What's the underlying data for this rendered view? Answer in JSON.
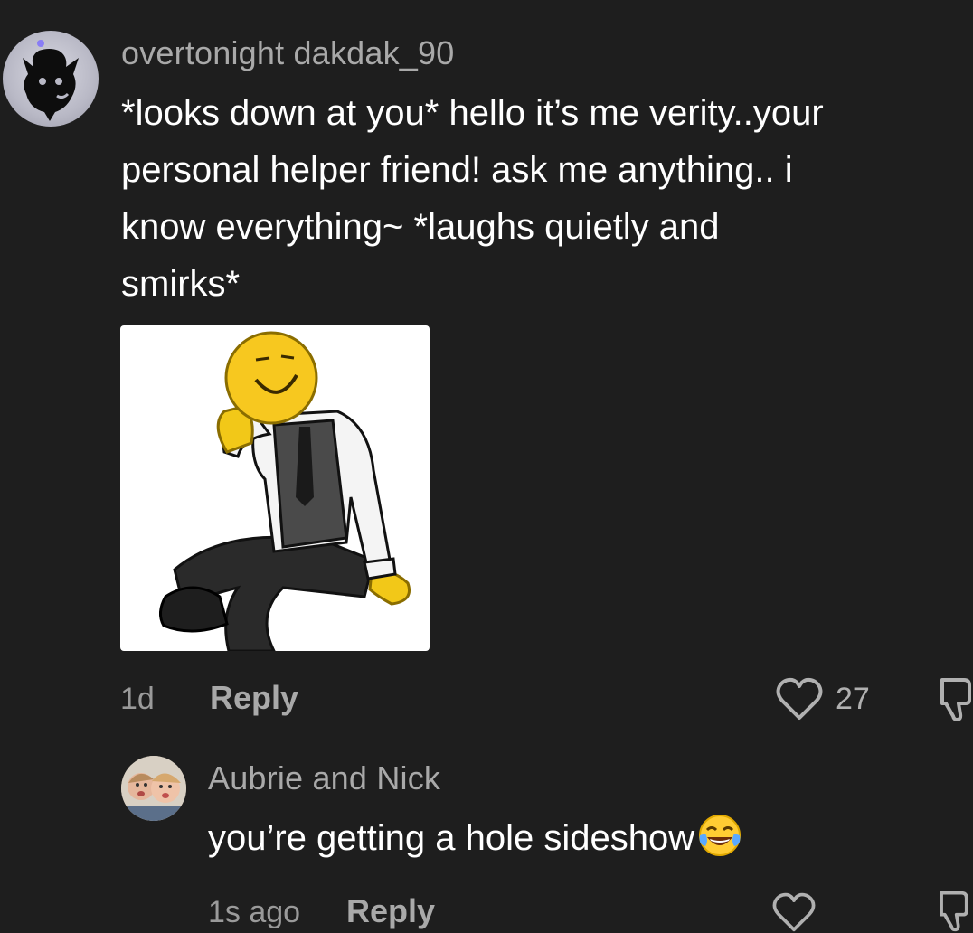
{
  "comment": {
    "username": "overtonight dakdak_90",
    "text": "*looks down at you* hello it’s me verity..your\npersonal helper friend! ask me anything.. i\nknow everything~ *laughs quietly and\nsmirks*",
    "time": "1d",
    "reply_label": "Reply",
    "like_count": "27"
  },
  "reply": {
    "username": "Aubrie and Nick",
    "text": "you’re getting a hole sideshow",
    "time": "1s ago",
    "reply_label": "Reply"
  },
  "icons": {
    "like": "heart-outline-icon",
    "dislike": "thumbs-down-outline-icon",
    "emoji": "face-with-tears-of-joy-emoji"
  },
  "colors": {
    "background": "#1e1e1e",
    "username": "#a9a9a9",
    "text": "#ffffff",
    "meta": "#9a9a9a"
  }
}
